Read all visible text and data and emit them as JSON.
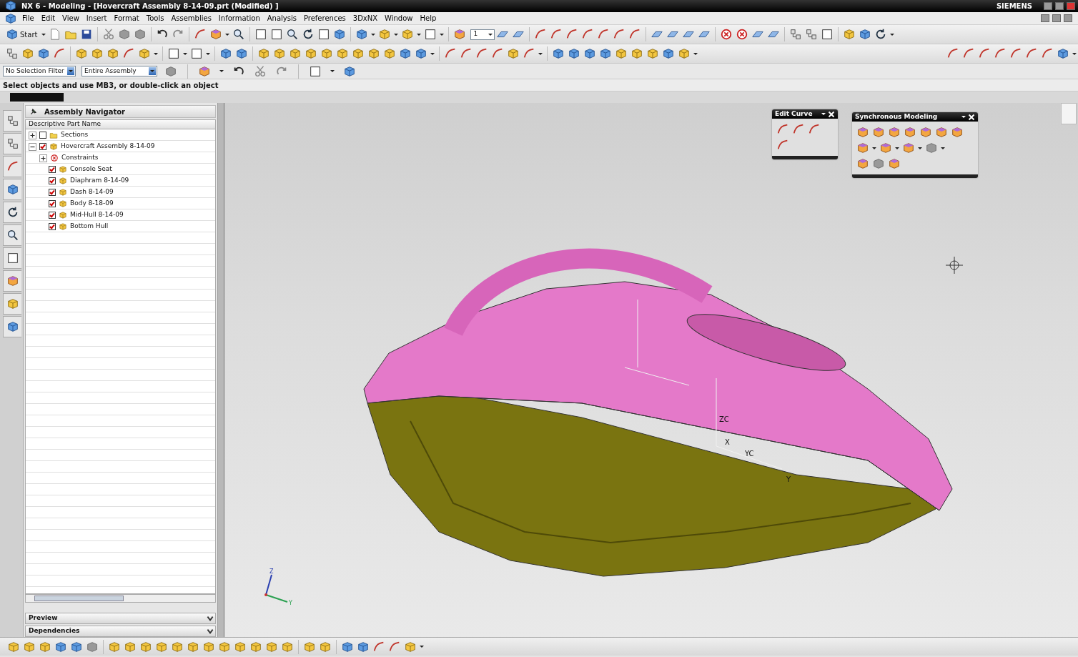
{
  "window": {
    "title": "NX 6 - Modeling - [Hovercraft Assembly 8-14-09.prt (Modified) ]",
    "brand": "SIEMENS"
  },
  "menu": [
    "File",
    "Edit",
    "View",
    "Insert",
    "Format",
    "Tools",
    "Assemblies",
    "Information",
    "Analysis",
    "Preferences",
    "3DxNX",
    "Window",
    "Help"
  ],
  "toolbar": {
    "start_label": "Start",
    "view_count": "1"
  },
  "selection_bar": {
    "filter": "No Selection Filter",
    "scope": "Entire Assembly"
  },
  "prompt": "Select objects and use MB3, or double-click an object",
  "navigator": {
    "title": "Assembly Navigator",
    "column": "Descriptive Part Name",
    "tree": [
      {
        "label": "Sections",
        "kind": "folder",
        "checked": false,
        "expanded": false
      },
      {
        "label": "Hovercraft Assembly 8-14-09",
        "kind": "assembly",
        "checked": true,
        "expanded": true,
        "children": [
          {
            "label": "Constraints",
            "kind": "constraints",
            "expanded": false
          },
          {
            "label": "Console Seat",
            "kind": "part",
            "checked": true
          },
          {
            "label": "Diaphram 8-14-09",
            "kind": "part",
            "checked": true
          },
          {
            "label": "Dash 8-14-09",
            "kind": "part",
            "checked": true
          },
          {
            "label": "Body 8-18-09",
            "kind": "part",
            "checked": true
          },
          {
            "label": "Mid-Hull 8-14-09",
            "kind": "part",
            "checked": true
          },
          {
            "label": "Bottom Hull",
            "kind": "part",
            "checked": true
          }
        ]
      }
    ],
    "panels": [
      "Preview",
      "Dependencies"
    ]
  },
  "floating_toolbars": [
    {
      "title": "Edit Curve"
    },
    {
      "title": "Synchronous Modeling"
    }
  ],
  "viewport": {
    "wcs_labels": [
      "ZC",
      "X",
      "YC",
      "Y"
    ],
    "triad_labels": [
      "Z",
      "Y"
    ]
  }
}
